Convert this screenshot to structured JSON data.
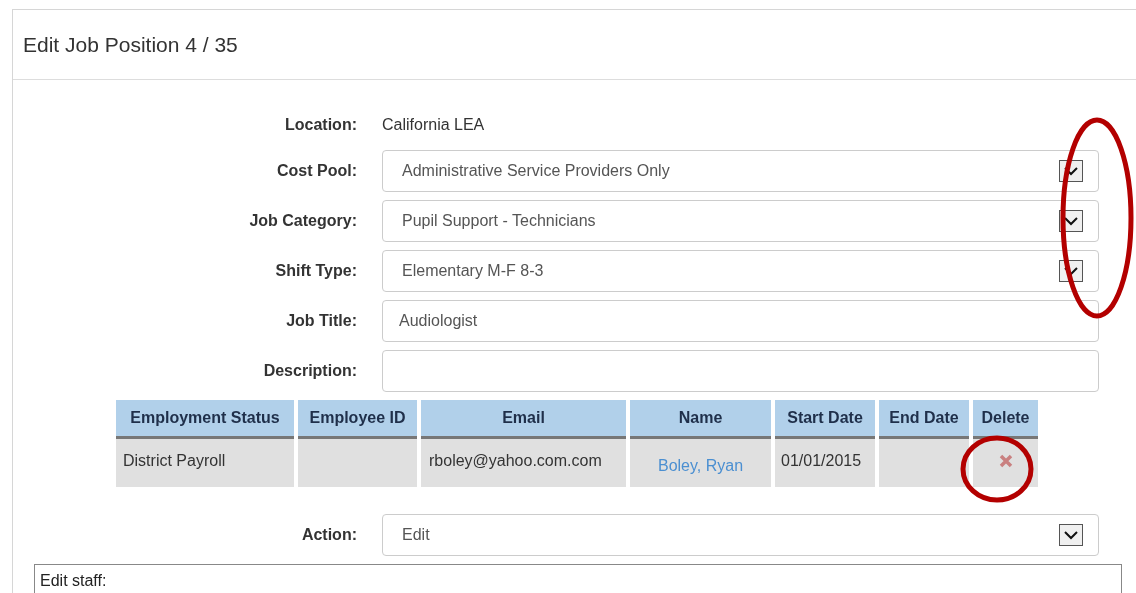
{
  "panel": {
    "title": "Edit Job Position 4 / 35"
  },
  "fields": [
    {
      "label": "Location:",
      "kind": "static",
      "value": "California LEA"
    },
    {
      "label": "Cost Pool:",
      "kind": "select",
      "value": "Administrative Service Providers Only"
    },
    {
      "label": "Job Category:",
      "kind": "select",
      "value": "Pupil Support - Technicians"
    },
    {
      "label": "Shift Type:",
      "kind": "select",
      "value": "Elementary M-F 8-3"
    },
    {
      "label": "Job Title:",
      "kind": "text",
      "value": "Audiologist"
    },
    {
      "label": "Description:",
      "kind": "text"
    }
  ],
  "table": {
    "columns": [
      "Employment Status",
      "Employee ID",
      "Email",
      "Name",
      "Start Date",
      "End Date",
      "Delete"
    ],
    "rows": [
      {
        "employment_status": "District Payroll",
        "email": "rboley@yahoo.com.com",
        "name": "Boley, Ryan",
        "start_date": "01/01/2015"
      }
    ]
  },
  "action": {
    "label": "Action:",
    "value": "Edit"
  },
  "notes": {
    "value": "Edit staff:"
  }
}
